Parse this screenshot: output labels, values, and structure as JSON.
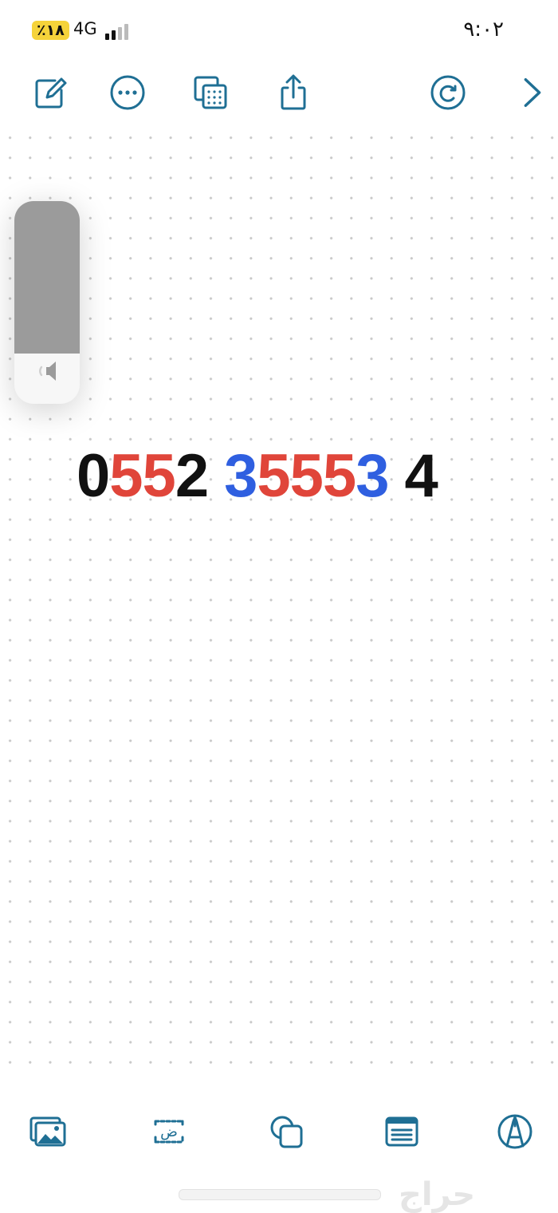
{
  "status_bar": {
    "battery": "٪١٨",
    "network": "4G",
    "time": "٩:٠٢"
  },
  "top_toolbar": {
    "icons": [
      "compose-icon",
      "more-icon",
      "copy-grid-icon",
      "share-icon",
      "redo-icon",
      "chevron-right-icon"
    ]
  },
  "volume_hud": {
    "level_fraction": 0.75,
    "icon": "speaker-icon"
  },
  "note": {
    "phone_segments": [
      {
        "text": "0",
        "color": "#111111"
      },
      {
        "text": "55",
        "color": "#e0453a"
      },
      {
        "text": "2",
        "color": "#111111"
      },
      {
        "text": " ",
        "color": "#111111"
      },
      {
        "text": "3",
        "color": "#2f5fe0"
      },
      {
        "text": "555",
        "color": "#e0453a"
      },
      {
        "text": "3",
        "color": "#2f5fe0"
      },
      {
        "text": " ",
        "color": "#111111"
      },
      {
        "text": "4",
        "color": "#111111"
      }
    ]
  },
  "bottom_toolbar": {
    "icons": [
      "photos-icon",
      "text-box-icon",
      "shapes-icon",
      "note-card-icon",
      "pen-tool-icon"
    ],
    "text_box_glyph": "ض"
  },
  "watermark": {
    "text": "حراج"
  },
  "colors": {
    "accent": "#1f6f94",
    "black": "#111111",
    "red": "#e0453a",
    "blue": "#2f5fe0"
  }
}
